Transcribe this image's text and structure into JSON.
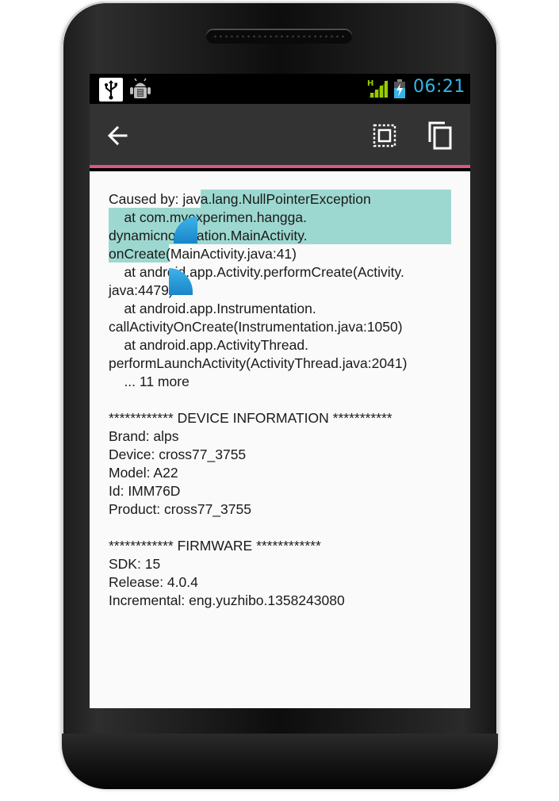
{
  "status_bar": {
    "time": "06:21",
    "icons": [
      "usb-icon",
      "debug-icon",
      "signal-h-icon",
      "battery-charging-icon"
    ],
    "signal_label": "H"
  },
  "action_bar": {
    "back_icon": "arrow-left-icon",
    "select_all_icon": "select-all-icon",
    "copy_icon": "copy-icon",
    "accent_color": "#d9587f",
    "bar_color": "#333333"
  },
  "log": {
    "lines": [
      "Caused by: java.lang.NullPointerException",
      "    at com.myexperimen.hangga.",
      "dynamicnotification.MainActivity.",
      "onCreate(MainActivity.java:41)",
      "    at android.app.Activity.performCreate(Activity.",
      "java:4479)",
      "    at android.app.Instrumentation.",
      "callActivityOnCreate(Instrumentation.java:1050)",
      "    at android.app.ActivityThread.",
      "performLaunchActivity(ActivityThread.java:2041)",
      "    ... 11 more",
      "",
      "************ DEVICE INFORMATION ***********",
      "Brand: alps",
      "Device: cross77_3755",
      "Model: A22",
      "Id: IMM76D",
      "Product: cross77_3755",
      "",
      "************ FIRMWARE ************",
      "SDK: 15",
      "Release: 4.0.4",
      "Incremental: eng.yuzhibo.1358243080"
    ],
    "selection_color": "#40b5a5",
    "handle_color": "#33b5e5"
  }
}
